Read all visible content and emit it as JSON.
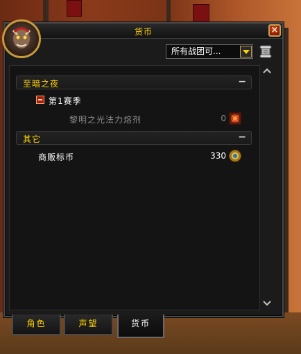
{
  "window": {
    "title": "货币",
    "close_icon": "close-icon"
  },
  "filter": {
    "selected": "所有战团可..."
  },
  "sections": [
    {
      "label": "至暗之夜",
      "collapse": "−",
      "subgroups": [
        {
          "label": "第1赛季",
          "items": [
            {
              "name": "黎明之光法力熔剂",
              "quantity": "0",
              "icon": "mana-flux-icon",
              "dimmed": true
            }
          ]
        }
      ]
    },
    {
      "label": "其它",
      "collapse": "−",
      "items": [
        {
          "name": "商贩标币",
          "quantity": "330",
          "icon": "trader-tender-icon",
          "dimmed": false
        }
      ]
    }
  ],
  "tabs": [
    {
      "label": "角色",
      "active": false
    },
    {
      "label": "声望",
      "active": false
    },
    {
      "label": "货币",
      "active": true
    }
  ],
  "colors": {
    "gold": "#ffd200",
    "dim_text": "#8a8a8a",
    "frame": "#1b1b1b"
  }
}
